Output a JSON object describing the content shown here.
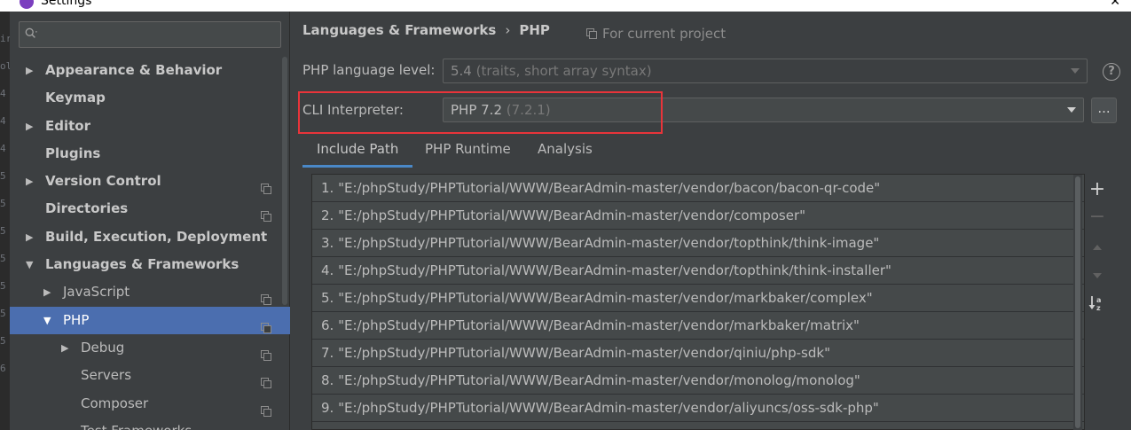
{
  "window": {
    "title": "Settings",
    "close_glyph": "✕"
  },
  "gutter": [
    "ir",
    "ol",
    "4",
    "4",
    "4",
    "5",
    "5",
    "5",
    "5",
    "5",
    "5",
    "5",
    "6"
  ],
  "sidebar": {
    "search_placeholder": "",
    "items": [
      {
        "label": "Appearance & Behavior",
        "level": 0,
        "arrow": "right",
        "bold": true,
        "copy": false
      },
      {
        "label": "Keymap",
        "level": 0,
        "arrow": "none",
        "bold": true,
        "copy": false
      },
      {
        "label": "Editor",
        "level": 0,
        "arrow": "right",
        "bold": true,
        "copy": false
      },
      {
        "label": "Plugins",
        "level": 0,
        "arrow": "none",
        "bold": true,
        "copy": false
      },
      {
        "label": "Version Control",
        "level": 0,
        "arrow": "right",
        "bold": true,
        "copy": true
      },
      {
        "label": "Directories",
        "level": 0,
        "arrow": "none",
        "bold": true,
        "copy": true
      },
      {
        "label": "Build, Execution, Deployment",
        "level": 0,
        "arrow": "right",
        "bold": true,
        "copy": false
      },
      {
        "label": "Languages & Frameworks",
        "level": 0,
        "arrow": "down",
        "bold": true,
        "copy": false
      },
      {
        "label": "JavaScript",
        "level": 1,
        "arrow": "right",
        "bold": false,
        "copy": true
      },
      {
        "label": "PHP",
        "level": 1,
        "arrow": "down",
        "bold": false,
        "copy": true,
        "selected": true
      },
      {
        "label": "Debug",
        "level": 2,
        "arrow": "right",
        "bold": false,
        "copy": true
      },
      {
        "label": "Servers",
        "level": 2,
        "arrow": "none",
        "bold": false,
        "copy": true
      },
      {
        "label": "Composer",
        "level": 2,
        "arrow": "none",
        "bold": false,
        "copy": true
      },
      {
        "label": "Test Frameworks",
        "level": 2,
        "arrow": "none",
        "bold": false,
        "copy": true
      }
    ]
  },
  "main": {
    "breadcrumb": {
      "parent": "Languages & Frameworks",
      "separator": "›",
      "current": "PHP"
    },
    "scope_label": "For current project",
    "language_level": {
      "label": "PHP language level:",
      "value": "5.4",
      "hint": "(traits, short array syntax)"
    },
    "cli_interpreter": {
      "label": "CLI Interpreter:",
      "value": "PHP 7.2",
      "hint": "(7.2.1)"
    },
    "help_glyph": "?",
    "browse_label": "...",
    "tabs": [
      {
        "label": "Include Path",
        "active": true
      },
      {
        "label": "PHP Runtime",
        "active": false
      },
      {
        "label": "Analysis",
        "active": false
      }
    ],
    "include_paths": [
      "1. \"E:/phpStudy/PHPTutorial/WWW/BearAdmin-master/vendor/bacon/bacon-qr-code\"",
      "2. \"E:/phpStudy/PHPTutorial/WWW/BearAdmin-master/vendor/composer\"",
      "3. \"E:/phpStudy/PHPTutorial/WWW/BearAdmin-master/vendor/topthink/think-image\"",
      "4. \"E:/phpStudy/PHPTutorial/WWW/BearAdmin-master/vendor/topthink/think-installer\"",
      "5. \"E:/phpStudy/PHPTutorial/WWW/BearAdmin-master/vendor/markbaker/complex\"",
      "6. \"E:/phpStudy/PHPTutorial/WWW/BearAdmin-master/vendor/markbaker/matrix\"",
      "7. \"E:/phpStudy/PHPTutorial/WWW/BearAdmin-master/vendor/qiniu/php-sdk\"",
      "8. \"E:/phpStudy/PHPTutorial/WWW/BearAdmin-master/vendor/monolog/monolog\"",
      "9. \"E:/phpStudy/PHPTutorial/WWW/BearAdmin-master/vendor/aliyuncs/oss-sdk-php\"",
      ""
    ],
    "toolbar": {
      "add": "+",
      "remove": "−",
      "sort": "↓ᵃz"
    }
  },
  "colors": {
    "accent": "#4b6eaf",
    "tab_underline": "#4a88c7",
    "highlight": "#e8343a",
    "background": "#3c3f41"
  }
}
